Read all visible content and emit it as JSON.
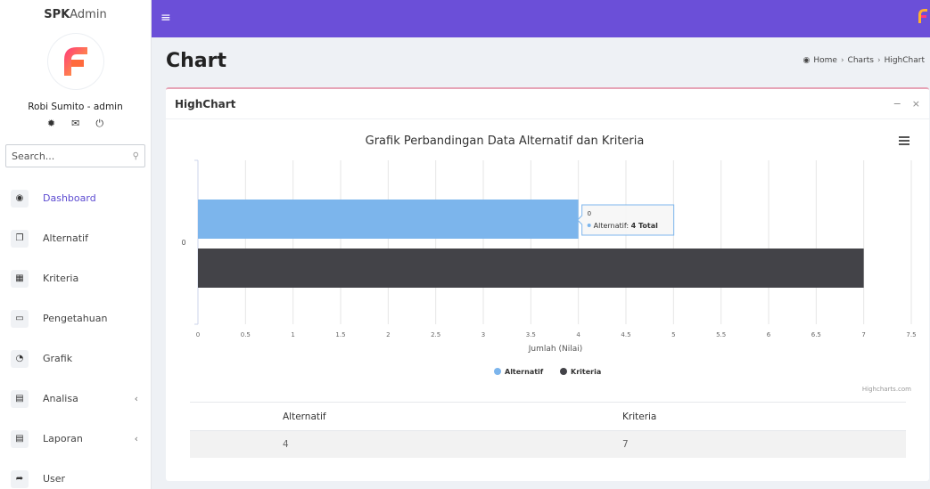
{
  "sidebar": {
    "brand_bold": "SPK",
    "brand_light": "Admin",
    "user_name": "Robi Sumito - admin",
    "user_actions": [
      "gear-icon",
      "mail-icon",
      "power-icon"
    ],
    "search_placeholder": "Search...",
    "items": [
      {
        "label": "Dashboard",
        "icon": "dashboard-icon",
        "active": true
      },
      {
        "label": "Alternatif",
        "icon": "copy-icon"
      },
      {
        "label": "Kriteria",
        "icon": "grid-icon"
      },
      {
        "label": "Pengetahuan",
        "icon": "laptop-icon"
      },
      {
        "label": "Grafik",
        "icon": "pie-chart-icon"
      },
      {
        "label": "Analisa",
        "icon": "table-icon",
        "caret": "‹"
      },
      {
        "label": "Laporan",
        "icon": "table-icon",
        "caret": "‹"
      },
      {
        "label": "User",
        "icon": "share-icon"
      }
    ]
  },
  "topbar": {
    "menu_icon": "hamburger-icon"
  },
  "page": {
    "title": "Chart",
    "breadcrumb": [
      "Home",
      "Charts",
      "HighChart"
    ]
  },
  "card": {
    "title": "HighChart",
    "minimize": "−",
    "close": "×"
  },
  "chart_data": {
    "type": "bar",
    "orientation": "horizontal",
    "title": "Grafik Perbandingan Data Alternatif dan Kriteria",
    "categories": [
      "0"
    ],
    "series": [
      {
        "name": "Alternatif",
        "values": [
          4
        ],
        "color": "#7cb5ec"
      },
      {
        "name": "Kriteria",
        "values": [
          7
        ],
        "color": "#434348"
      }
    ],
    "xlabel": "Jumlah (Nilai)",
    "xlim": [
      0,
      7.5
    ],
    "ticks": [
      "0",
      "0.5",
      "1",
      "1.5",
      "2",
      "2.5",
      "3",
      "3.5",
      "4",
      "4.5",
      "5",
      "5.5",
      "6",
      "6.5",
      "7",
      "7.5"
    ],
    "grid": true,
    "legend": "bottom-center",
    "tooltip": {
      "category": "0",
      "series": "Alternatif",
      "value": "4 Total"
    },
    "credits": "Highcharts.com",
    "menu_icon": "chart-menu-icon"
  },
  "table": {
    "headers": [
      "",
      "Alternatif",
      "Kriteria"
    ],
    "rows": [
      [
        "",
        "4",
        "7"
      ]
    ]
  },
  "colors": {
    "topbar": "#6b4fd8",
    "accent": "#5c4bd1",
    "card_border": "#e6a4b6"
  }
}
